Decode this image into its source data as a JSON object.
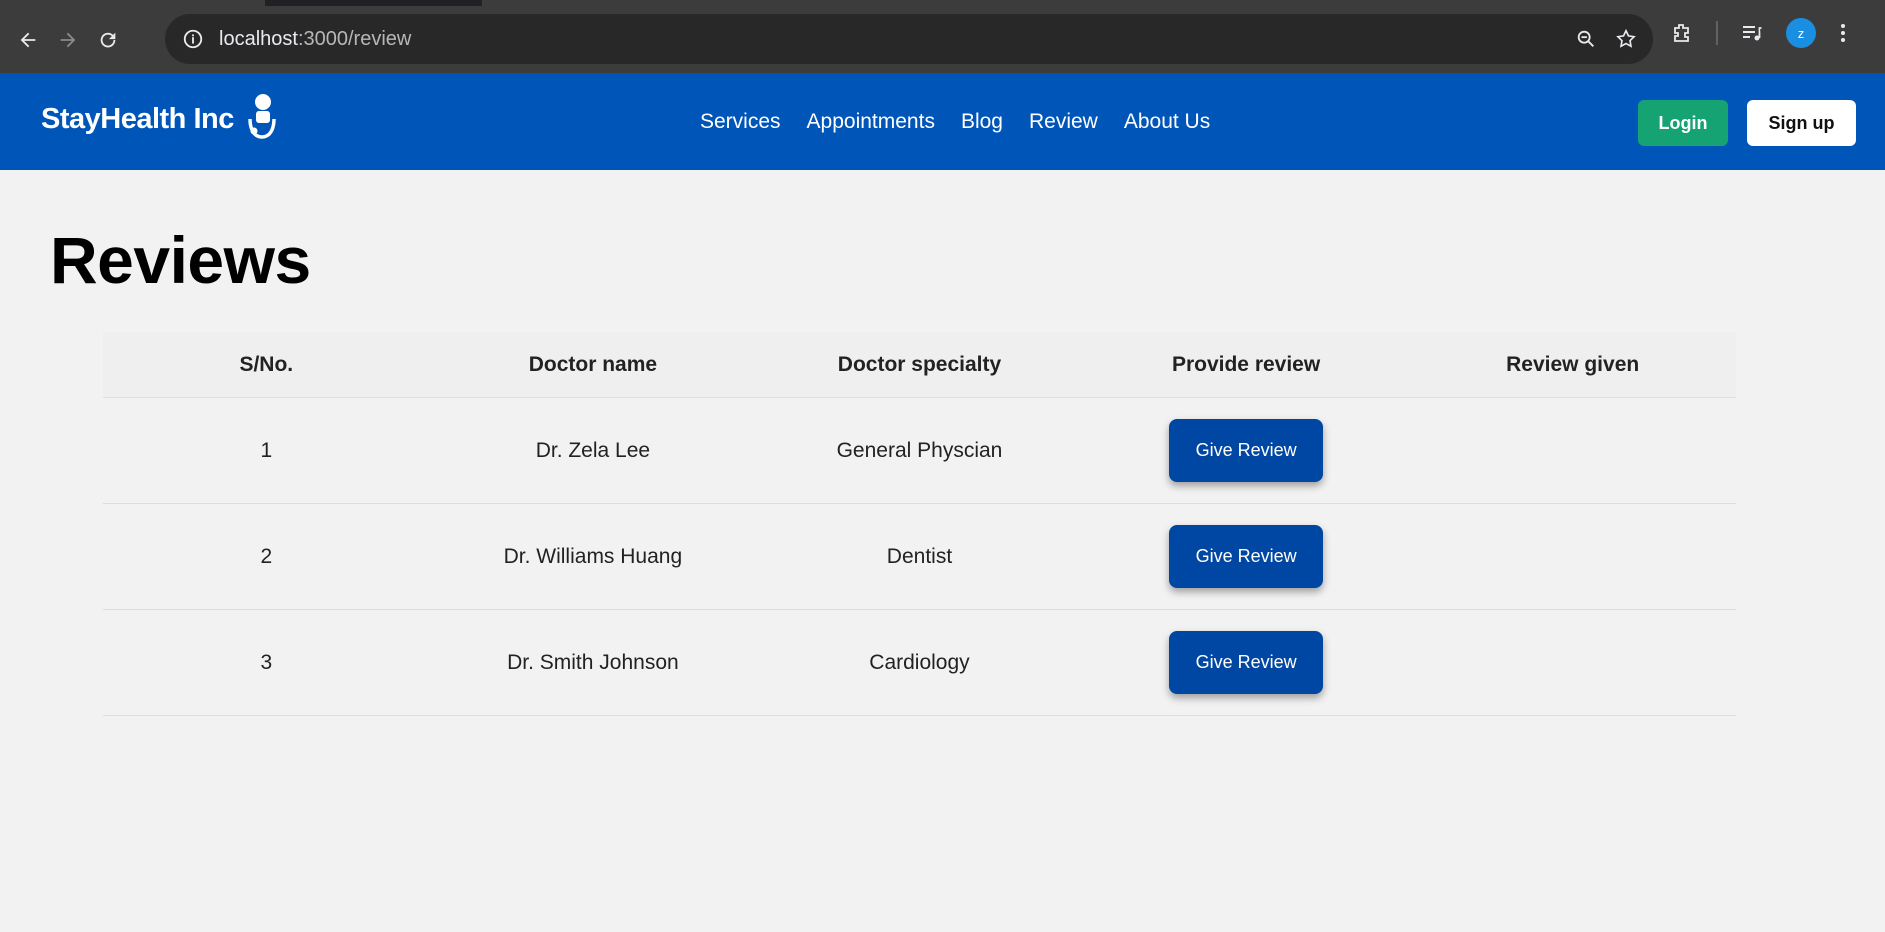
{
  "browser": {
    "url_host": "localhost",
    "url_path": ":3000/review",
    "profile_initial": "z"
  },
  "header": {
    "brand": "StayHealth Inc",
    "nav": [
      "Services",
      "Appointments",
      "Blog",
      "Review",
      "About Us"
    ],
    "login_label": "Login",
    "signup_label": "Sign up"
  },
  "main": {
    "title": "Reviews",
    "columns": [
      "S/No.",
      "Doctor name",
      "Doctor specialty",
      "Provide review",
      "Review given"
    ],
    "rows": [
      {
        "sno": "1",
        "doctor": "Dr. Zela Lee",
        "specialty": "General Physcian",
        "button": "Give Review",
        "review": ""
      },
      {
        "sno": "2",
        "doctor": "Dr. Williams Huang",
        "specialty": "Dentist",
        "button": "Give Review",
        "review": ""
      },
      {
        "sno": "3",
        "doctor": "Dr. Smith Johnson",
        "specialty": "Cardiology",
        "button": "Give Review",
        "review": ""
      }
    ]
  },
  "colors": {
    "header_bg": "#0055b8",
    "login_bg": "#15a374",
    "give_review_bg": "#0047a3"
  }
}
